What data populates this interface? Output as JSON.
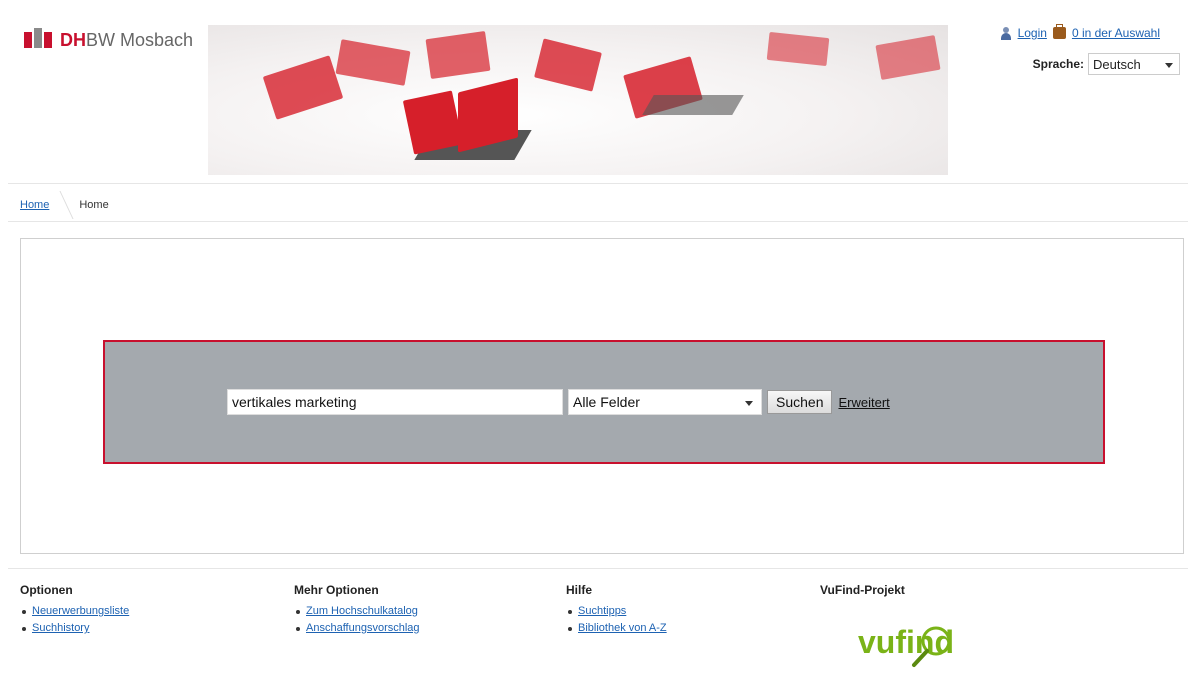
{
  "header": {
    "logo_prefix": "DH",
    "logo_rest": "BW Mosbach",
    "login_label": "Login",
    "cart_label": "0 in der Auswahl",
    "language_label": "Sprache:",
    "language_value": "Deutsch"
  },
  "breadcrumb": {
    "home_link": "Home",
    "current": "Home"
  },
  "search": {
    "query": "vertikales marketing",
    "type_value": "Alle Felder",
    "submit_label": "Suchen",
    "advanced_label": "Erweitert"
  },
  "footer": {
    "columns": [
      {
        "title": "Optionen",
        "links": [
          "Neuerwerbungsliste",
          "Suchhistory"
        ]
      },
      {
        "title": "Mehr Optionen",
        "links": [
          "Zum Hochschulkatalog",
          "Anschaffungsvorschlag"
        ]
      },
      {
        "title": "Hilfe",
        "links": [
          "Suchtipps",
          "Bibliothek von A-Z"
        ]
      },
      {
        "title": "VuFind-Projekt",
        "links": []
      }
    ],
    "vufind_logo_text": "vufind"
  },
  "colors": {
    "accent_red": "#c8102e",
    "link_blue": "#1d62b2",
    "search_bg": "#a4a9ae",
    "vufind_green": "#7ab317"
  },
  "icons": {
    "login": "user-icon",
    "cart": "bag-icon",
    "vufind_magnifier": "magnifier-icon"
  }
}
